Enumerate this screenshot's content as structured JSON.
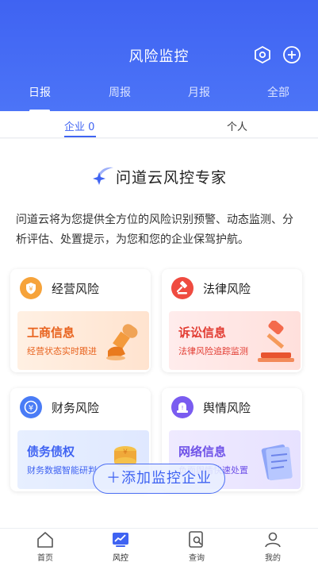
{
  "header": {
    "title": "风险监控",
    "settings_icon": "hexagon-settings-icon",
    "add_icon": "plus-circle-icon",
    "colors": {
      "primary": "#3f63f2",
      "text": "#ffffff"
    }
  },
  "tabs": [
    {
      "label": "日报",
      "active": true
    },
    {
      "label": "周报",
      "active": false
    },
    {
      "label": "月报",
      "active": false
    },
    {
      "label": "全部",
      "active": false
    }
  ],
  "subtabs": [
    {
      "label": "企业 0",
      "active": true
    },
    {
      "label": "个人",
      "active": false
    }
  ],
  "brand": {
    "name": "问道云风控专家",
    "description": "问道云将为您提供全方位的风险识别预警、动态监测、分析评估、处置提示，为您和您的企业保驾护航。"
  },
  "cards": [
    {
      "title": "经营风险",
      "icon": "shield-badge-icon",
      "inner_title": "工商信息",
      "inner_sub": "经营状态实时跟进",
      "color": "#f6a33a"
    },
    {
      "title": "法律风险",
      "icon": "gavel-icon",
      "inner_title": "诉讼信息",
      "inner_sub": "法律风险追踪监测",
      "color": "#ef4b40"
    },
    {
      "title": "财务风险",
      "icon": "yen-circle-icon",
      "inner_title": "债务债权",
      "inner_sub": "财务数据智能研判",
      "color": "#4a7cf6"
    },
    {
      "title": "舆情风险",
      "icon": "alarm-light-icon",
      "inner_title": "网络信息",
      "inner_sub": "负面舆情快速处置",
      "color": "#7a5cf0"
    }
  ],
  "add_button": {
    "label": "＋添加监控企业"
  },
  "bottom_nav": [
    {
      "label": "首页",
      "icon": "home-icon",
      "active": false
    },
    {
      "label": "风控",
      "icon": "chart-monitor-icon",
      "active": true
    },
    {
      "label": "查询",
      "icon": "search-document-icon",
      "active": false
    },
    {
      "label": "我的",
      "icon": "user-icon",
      "active": false
    }
  ]
}
